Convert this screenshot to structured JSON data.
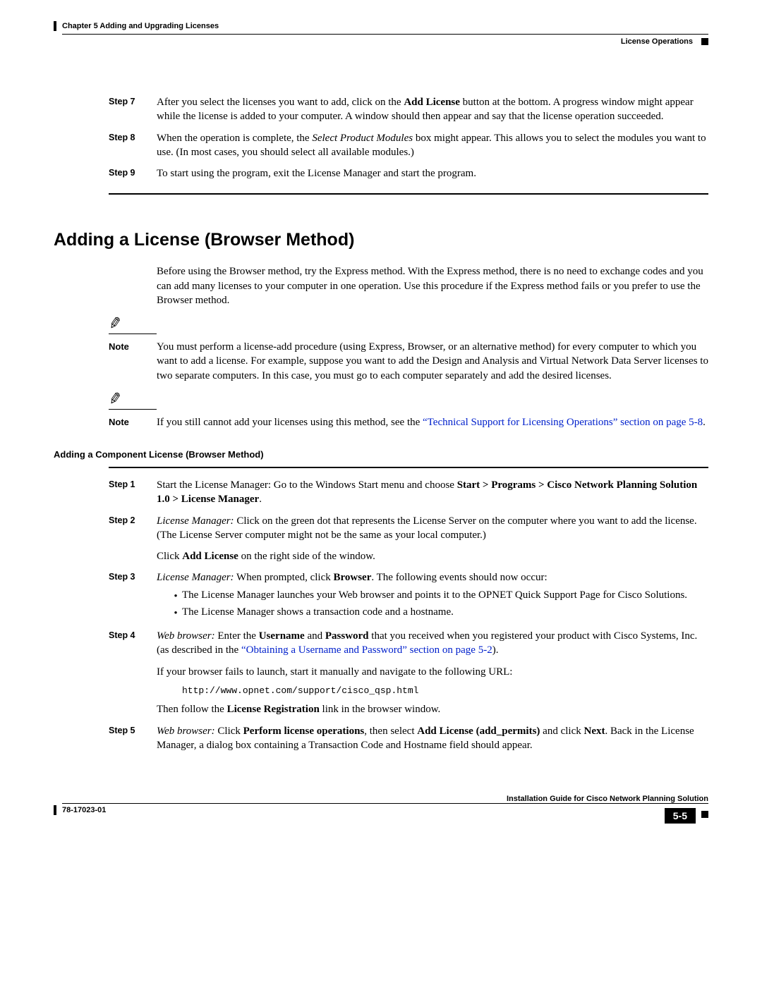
{
  "header": {
    "chapter": "Chapter 5    Adding and Upgrading Licenses",
    "section": "License Operations"
  },
  "steps_top": [
    {
      "label": "Step 7",
      "html": "After you select the licenses you want to add, click on the <b>Add License</b> button at the bottom. A progress window might appear while the license is added to your computer. A window should then appear and say that the license operation succeeded."
    },
    {
      "label": "Step 8",
      "html": "When the operation is complete, the <i>Select Product Modules</i> box might appear. This allows you to select the modules you want to use. (In most cases, you should select all available modules.)"
    },
    {
      "label": "Step 9",
      "html": "To start using the program, exit the License Manager and start the program."
    }
  ],
  "section_title": "Adding a License (Browser Method)",
  "intro_para": "Before using the Browser method, try the Express method. With the Express method, there is no need to exchange codes and you can add many licenses to your computer in one operation. Use this procedure if the Express method fails or you prefer to use the Browser method.",
  "notes": [
    {
      "label": "Note",
      "html": "You must perform a license-add procedure (using Express, Browser, or an alternative method) for every computer to which you want to add a license. For example, suppose you want to add the Design and Analysis and Virtual Network Data Server licenses to two separate computers. In this case, you must go to each computer separately and add the desired licenses."
    },
    {
      "label": "Note",
      "html": "If you still cannot add your licenses using this method, see the <span class=\"link\">“Technical Support for Licensing Operations” section on page 5-8</span>."
    }
  ],
  "subheading": "Adding a Component License (Browser Method)",
  "steps_bottom": [
    {
      "label": "Step 1",
      "html": "Start the License Manager: Go to the Windows Start menu and choose <b>Start &gt; Programs &gt; Cisco Network Planning Solution 1.0 &gt; License Manager</b>."
    },
    {
      "label": "Step 2",
      "html": "<i>License Manager:</i> Click on the green dot that represents the License Server on the computer where you want to add the license. (The License Server computer might not be the same as your local computer.)<div style=\"margin-top:10px\">Click <b>Add License</b> on the right side of the window.</div>"
    },
    {
      "label": "Step 3",
      "html": "<i>License Manager:</i> When prompted, click <b>Browser</b>. The following events should now occur:",
      "bullets": [
        "The License Manager launches your Web browser and points it to the OPNET Quick Support Page for Cisco Solutions.",
        "The License Manager shows a transaction code and a hostname."
      ]
    },
    {
      "label": "Step 4",
      "html": "<i>Web browser:</i> Enter the <b>Username</b> and <b>Password</b> that you received when you registered your product with Cisco Systems, Inc. (as described in the <span class=\"link\">“Obtaining a Username and Password” section on page 5-2</span>).<div style=\"margin-top:10px\">If your browser fails to launch, start it manually and navigate to the following URL:</div><div class=\"code-block mono\">http://www.opnet.com/support/cisco_qsp.html</div><div>Then follow the <b>License Registration</b> link in the browser window.</div>"
    },
    {
      "label": "Step 5",
      "html": "<i>Web browser:</i> Click <b>Perform license operations</b>, then select <b>Add License (add_permits)</b> and click <b>Next</b>. Back in the License Manager, a dialog box containing a Transaction Code and Hostname field should appear."
    }
  ],
  "footer": {
    "doc_title": "Installation Guide for Cisco Network Planning Solution",
    "doc_num": "78-17023-01",
    "page": "5-5"
  }
}
